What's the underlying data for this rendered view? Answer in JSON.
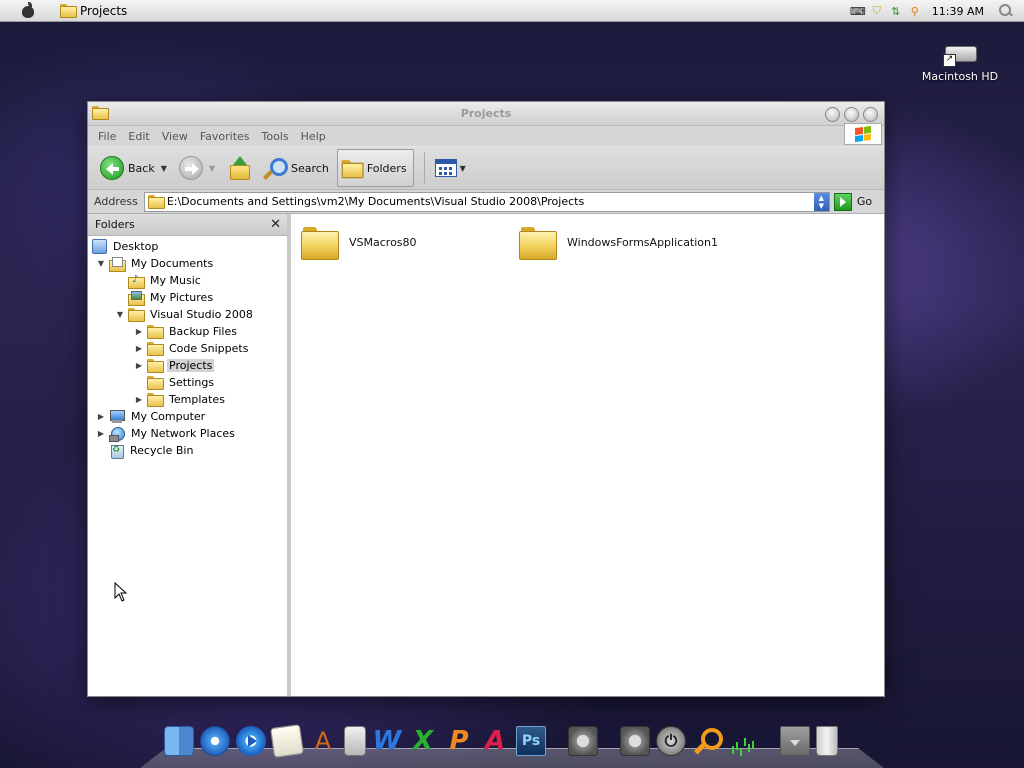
{
  "menubar": {
    "app_title": "Projects",
    "clock": "11:39 AM",
    "tray_icons": [
      "keyboard-icon",
      "security-shield-icon",
      "network-icon",
      "magnifier-icon"
    ]
  },
  "desktop": {
    "icons": [
      {
        "label": "Macintosh HD",
        "icon": "hard-drive-icon"
      }
    ]
  },
  "window": {
    "title": "Projects",
    "menu": [
      "File",
      "Edit",
      "View",
      "Favorites",
      "Tools",
      "Help"
    ],
    "toolbar": {
      "back_label": "Back",
      "search_label": "Search",
      "folders_label": "Folders"
    },
    "address": {
      "label": "Address",
      "value": "E:\\Documents and Settings\\vm2\\My Documents\\Visual Studio 2008\\Projects",
      "go_label": "Go"
    },
    "folders_pane": {
      "title": "Folders",
      "close": "✕",
      "tree": [
        {
          "label": "Desktop",
          "icon": "desktop-icon",
          "level": 0,
          "toggle": ""
        },
        {
          "label": "My Documents",
          "icon": "my-documents-icon",
          "level": 1,
          "toggle": "expanded"
        },
        {
          "label": "My Music",
          "icon": "my-music-icon",
          "level": 2,
          "toggle": ""
        },
        {
          "label": "My Pictures",
          "icon": "my-pictures-icon",
          "level": 2,
          "toggle": ""
        },
        {
          "label": "Visual Studio 2008",
          "icon": "folder-icon",
          "level": 2,
          "toggle": "expanded"
        },
        {
          "label": "Backup Files",
          "icon": "folder-icon",
          "level": 3,
          "toggle": "collapsed"
        },
        {
          "label": "Code Snippets",
          "icon": "folder-icon",
          "level": 3,
          "toggle": "collapsed"
        },
        {
          "label": "Projects",
          "icon": "folder-icon",
          "level": 3,
          "toggle": "collapsed",
          "selected": true
        },
        {
          "label": "Settings",
          "icon": "folder-icon",
          "level": 3,
          "toggle": ""
        },
        {
          "label": "Templates",
          "icon": "folder-icon",
          "level": 3,
          "toggle": "collapsed"
        },
        {
          "label": "My Computer",
          "icon": "my-computer-icon",
          "level": 1,
          "toggle": "collapsed"
        },
        {
          "label": "My Network Places",
          "icon": "network-places-icon",
          "level": 1,
          "toggle": "collapsed"
        },
        {
          "label": "Recycle Bin",
          "icon": "recycle-bin-icon",
          "level": 1,
          "toggle": ""
        }
      ]
    },
    "files": [
      {
        "label": "VSMacros80",
        "icon": "folder-icon"
      },
      {
        "label": "WindowsFormsApplication1",
        "icon": "folder-icon"
      }
    ]
  },
  "dock": {
    "items": [
      "finder-icon",
      "safari-icon",
      "itunes-icon",
      "notes-icon",
      "applications-icon",
      "calculator-icon",
      "word-icon",
      "excel-icon",
      "powerpoint-icon",
      "access-icon",
      "photoshop-icon",
      "system-preferences-icon",
      "system-preferences-2-icon",
      "shutdown-icon",
      "spotlight-icon",
      "activity-monitor-icon",
      "stack-icon",
      "trash-icon"
    ],
    "photoshop_label": "Ps"
  }
}
